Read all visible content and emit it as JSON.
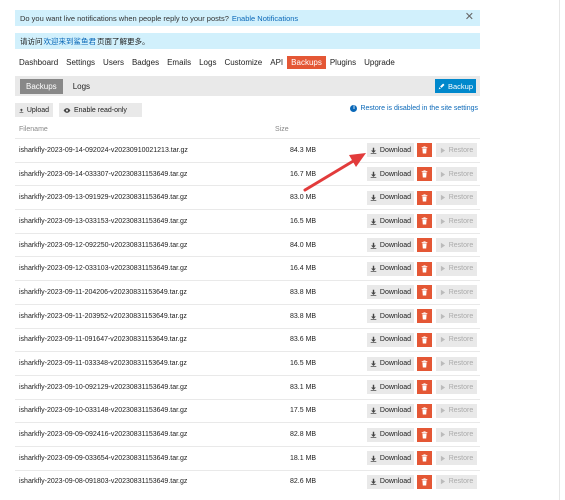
{
  "notices": {
    "live": {
      "text": "Do you want live notifications when people reply to your posts?",
      "link": "Enable Notifications",
      "close_glyph": "✕"
    },
    "welcome": {
      "prefix": "请访问",
      "link": "欢迎来到鲨鱼君",
      "suffix": "页面了解更多。"
    }
  },
  "nav": {
    "items": [
      "Dashboard",
      "Settings",
      "Users",
      "Badges",
      "Emails",
      "Logs",
      "Customize",
      "API",
      "Backups",
      "Plugins",
      "Upgrade"
    ],
    "active": "Backups"
  },
  "subtabs": {
    "backups": "Backups",
    "logs": "Logs",
    "backup_button": "Backup"
  },
  "actions": {
    "upload": "Upload",
    "enable_readonly": "Enable read-only",
    "restore_note": "Restore is disabled in the site settings"
  },
  "table": {
    "headers": {
      "filename": "Filename",
      "size": "Size"
    },
    "download_label": "Download",
    "restore_label": "Restore",
    "rows": [
      {
        "filename": "isharkfly-2023-09-14-092024-v20230910021213.tar.gz",
        "size": "84.3 MB"
      },
      {
        "filename": "isharkfly-2023-09-14-033307-v20230831153649.tar.gz",
        "size": "16.7 MB"
      },
      {
        "filename": "isharkfly-2023-09-13-091929-v20230831153649.tar.gz",
        "size": "83.0 MB"
      },
      {
        "filename": "isharkfly-2023-09-13-033153-v20230831153649.tar.gz",
        "size": "16.5 MB"
      },
      {
        "filename": "isharkfly-2023-09-12-092250-v20230831153649.tar.gz",
        "size": "84.0 MB"
      },
      {
        "filename": "isharkfly-2023-09-12-033103-v20230831153649.tar.gz",
        "size": "16.4 MB"
      },
      {
        "filename": "isharkfly-2023-09-11-204206-v20230831153649.tar.gz",
        "size": "83.8 MB"
      },
      {
        "filename": "isharkfly-2023-09-11-203952-v20230831153649.tar.gz",
        "size": "83.8 MB"
      },
      {
        "filename": "isharkfly-2023-09-11-091647-v20230831153649.tar.gz",
        "size": "83.6 MB"
      },
      {
        "filename": "isharkfly-2023-09-11-033348-v20230831153649.tar.gz",
        "size": "16.5 MB"
      },
      {
        "filename": "isharkfly-2023-09-10-092129-v20230831153649.tar.gz",
        "size": "83.1 MB"
      },
      {
        "filename": "isharkfly-2023-09-10-033148-v20230831153649.tar.gz",
        "size": "17.5 MB"
      },
      {
        "filename": "isharkfly-2023-09-09-092416-v20230831153649.tar.gz",
        "size": "82.8 MB"
      },
      {
        "filename": "isharkfly-2023-09-09-033654-v20230831153649.tar.gz",
        "size": "18.1 MB"
      },
      {
        "filename": "isharkfly-2023-09-08-091803-v20230831153649.tar.gz",
        "size": "82.6 MB"
      }
    ]
  },
  "colors": {
    "accent": "#e45735",
    "primary": "#0088cc",
    "notice_bg": "#d1f0fc",
    "link": "#0a68b8",
    "annotation_arrow": "#e23b3b"
  },
  "icons": {
    "download": "download-icon",
    "trash": "trash-icon",
    "restore": "play-icon",
    "upload": "upload-icon",
    "readonly": "eye-icon",
    "backup": "rocket-icon",
    "info": "info-circle-icon",
    "close": "close-icon"
  }
}
